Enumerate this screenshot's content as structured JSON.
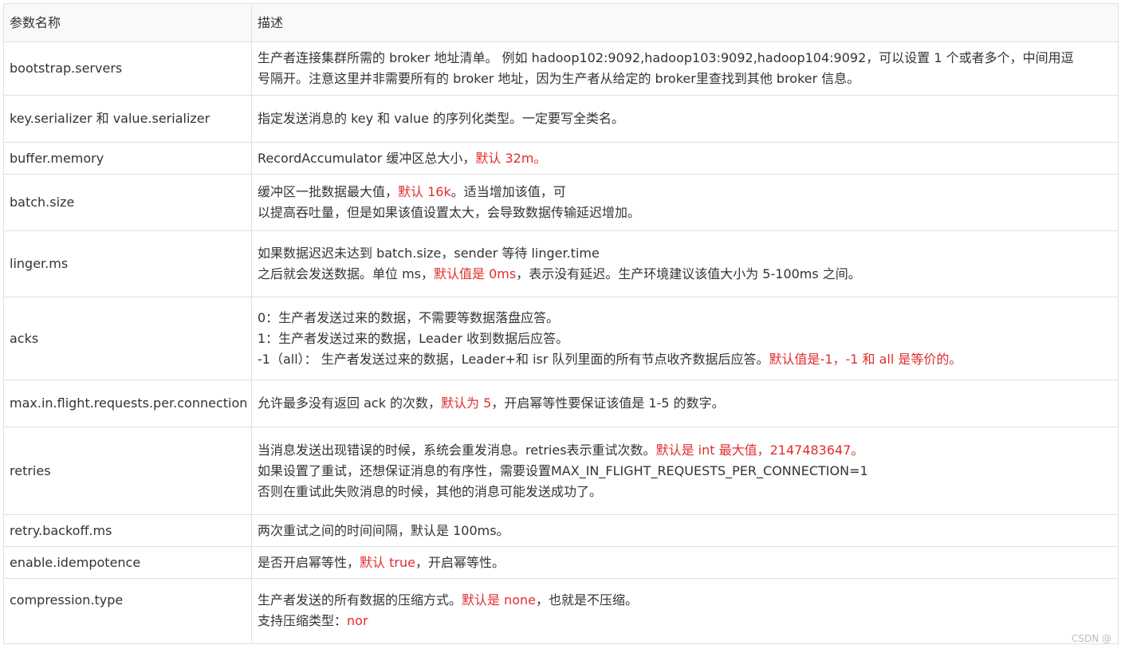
{
  "header": {
    "col_name": "参数名称",
    "col_desc": "描述"
  },
  "rows": [
    {
      "name": "bootstrap.servers",
      "lines": [
        [
          {
            "t": "生产者连接集群所需的 broker  地址清单。 例如 hadoop102:9092,hadoop103:9092,hadoop104:9092，可以设置 1 个或者多个，中间用逗"
          }
        ],
        [
          {
            "t": "号隔开。注意这里并非需要所有的 broker 地址，因为生产者从给定的 broker里查找到其他 broker 信息。"
          }
        ]
      ]
    },
    {
      "name": "key.serializer 和 value.serializer",
      "lines": [
        [
          {
            "t": "指定发送消息的 key 和 value  的序列化类型。一定要写全类名。"
          }
        ]
      ]
    },
    {
      "name": "buffer.memory",
      "lines": [
        [
          {
            "t": "RecordAccumulator 缓冲区总大小，"
          },
          {
            "t": "默认 32m。",
            "red": true
          }
        ]
      ]
    },
    {
      "name": "batch.size",
      "lines": [
        [
          {
            "t": "缓冲区一批数据最大值，"
          },
          {
            "t": "默认 16k",
            "red": true
          },
          {
            "t": "。适当增加该值，可"
          }
        ],
        [
          {
            "t": "以提高吞吐量，但是如果该值设置太大，会导致数据传输延迟增加。"
          }
        ]
      ]
    },
    {
      "name": "linger.ms",
      "lines": [
        [
          {
            "t": "如果数据迟迟未达到 batch.size，sender 等待 linger.time"
          }
        ],
        [
          {
            "t": "之后就会发送数据。单位 ms，"
          },
          {
            "t": "默认值是 0ms",
            "red": true
          },
          {
            "t": "，表示没有延迟。生产环境建议该值大小为  5-100ms 之间。"
          }
        ]
      ]
    },
    {
      "name": "acks",
      "lines": [
        [
          {
            "t": "0：生产者发送过来的数据，不需要等数据落盘应答。"
          }
        ],
        [
          {
            "t": "1：生产者发送过来的数据，Leader 收到数据后应答。"
          }
        ],
        [
          {
            "t": "-1（all）：  生产者发送过来的数据，Leader+和 isr 队列里面的所有节点收齐数据后应答。"
          },
          {
            "t": "默认值是-1，-1 和 all 是等价的。",
            "red": true
          }
        ]
      ]
    },
    {
      "name": "max.in.flight.requests.per.connection",
      "small": true,
      "lines": [
        [
          {
            "t": "允许最多没有返回 ack 的次数，"
          },
          {
            "t": "默认为  5",
            "red": true
          },
          {
            "t": "，开启幂等性要保证该值是 1-5 的数字。"
          }
        ]
      ]
    },
    {
      "name": "retries",
      "lines": [
        [
          {
            "t": "当消息发送出现错误的时候，系统会重发消息。retries表示重试次数。"
          },
          {
            "t": "默认是 int 最大值，2147483647。",
            "red": true
          }
        ],
        [
          {
            "t": "如果设置了重试，还想保证消息的有序性，需要设置MAX_IN_FLIGHT_REQUESTS_PER_CONNECTION=1"
          }
        ],
        [
          {
            "t": "否则在重试此失败消息的时候，其他的消息可能发送成功了。"
          }
        ]
      ]
    },
    {
      "name": "retry.backoff.ms",
      "lines": [
        [
          {
            "t": "两次重试之间的时间间隔，默认是 100ms。"
          }
        ]
      ]
    },
    {
      "name": "enable.idempotence",
      "lines": [
        [
          {
            "t": "是否开启幂等性，"
          },
          {
            "t": "默认 true",
            "red": true
          },
          {
            "t": "，开启幂等性。"
          }
        ]
      ]
    },
    {
      "name": "compression.type",
      "cut": true,
      "lines": [
        [
          {
            "t": "生产者发送的所有数据的压缩方式。"
          },
          {
            "t": "默认是 none",
            "red": true
          },
          {
            "t": "，也就是不压缩。"
          }
        ],
        [
          {
            "t": "支持压缩类型："
          },
          {
            "t": "nor",
            "red": true
          }
        ]
      ]
    }
  ],
  "colors": {
    "highlight": "#e22d2d",
    "text": "#333333",
    "border": "#e0e0e0"
  },
  "watermark": "CSDN @"
}
